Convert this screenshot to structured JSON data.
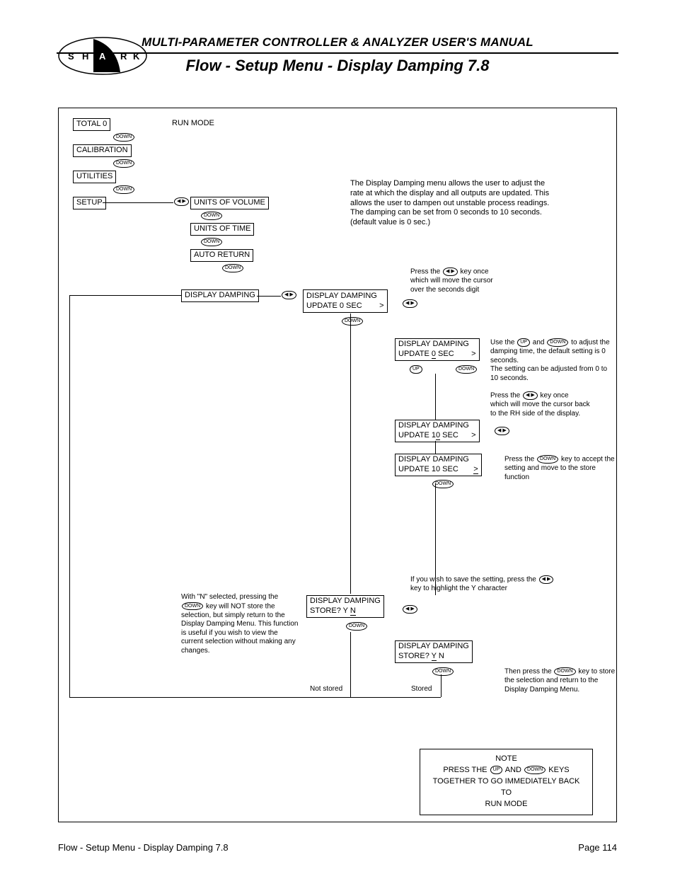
{
  "header": {
    "manual_title": "MULTI-PARAMETER CONTROLLER & ANALYZER USER'S MANUAL",
    "page_title": "Flow - Setup Menu - Display Damping 7.8",
    "logo_letters": [
      "S",
      "H",
      "A",
      "R",
      "K"
    ]
  },
  "footer": {
    "left": "Flow - Setup Menu - Display Damping 7.8",
    "right": "Page 114"
  },
  "menu": {
    "total": "TOTAL      0",
    "run_mode": "RUN MODE",
    "calibration": "CALIBRATION",
    "utilities": "UTILITIES",
    "setup": "SETUP",
    "units_volume": "UNITS OF VOLUME",
    "units_time": "UNITS OF TIME",
    "auto_return": "AUTO RETURN",
    "display_damping": "DISPLAY DAMPING"
  },
  "keys": {
    "down": "DOWN",
    "up": "UP",
    "lr": "◀ ▶"
  },
  "blocks": {
    "dd1_a": "DISPLAY DAMPING",
    "dd1_b": "UPDATE  0 SEC",
    "dd2_a": "DISPLAY DAMPING",
    "dd2_b_pre": "UPDATE ",
    "dd2_b_val": "0",
    "dd2_b_post": " SEC",
    "dd3_a": "DISPLAY DAMPING",
    "dd3_b_pre": "UPDATE  1",
    "dd3_b_val": "0",
    "dd3_b_post": " SEC",
    "dd4_a": "DISPLAY DAMPING",
    "dd4_b": "UPDATE  10 SEC",
    "store1_a": "DISPLAY DAMPING",
    "store1_b_pre": "STORE?           Y ",
    "store1_b_val": "N",
    "store2_a": "DISPLAY DAMPING",
    "store2_b_pre": "STORE?          ",
    "store2_b_val": "Y",
    "store2_b_post": "  N"
  },
  "notes": {
    "intro": "The Display Damping menu allows the user to adjust the rate at which the display and all outputs are updated. This allows the user to dampen out unstable process readings.\nThe damping can be set from 0 seconds to 10 seconds. (default value is 0 sec.)",
    "press_lr_1": "Press the  ◀ ▶  key once\nwhich will move the cursor\nover the seconds digit",
    "use_updown": "Use the  UP  and  DOWN  to adjust\nthe damping time, the default setting is\n0 seconds.\nThe setting can be adjusted from 0 to\n10 seconds.",
    "press_lr_2": "Press the  ◀ ▶  key once\nwhich will move the cursor back\nto the RH side of the display.",
    "press_down_accept": "Press the  DOWN  key to accept the setting and move to the store function",
    "save_prompt": "If you wish to save the setting, press the  ◀ ▶\nkey to highlight the Y character",
    "n_selected": "With \"N\" selected, pressing the  DOWN\nkey will NOT store the selection, but\nsimply return to the Display Damping\nMenu. This function is useful if you\nwish to view the current selection\nwithout making any changes.",
    "then_press_down": "Then press the  DOWN  key to store the\nselection and return to the Display\nDamping Menu.",
    "not_stored": "Not stored",
    "stored": "Stored"
  },
  "note_box": {
    "title": "NOTE",
    "body_pre": "PRESS THE ",
    "body_mid": " AND ",
    "body_post": " KEYS\nTOGETHER TO GO IMMEDIATELY BACK TO\nRUN MODE"
  }
}
